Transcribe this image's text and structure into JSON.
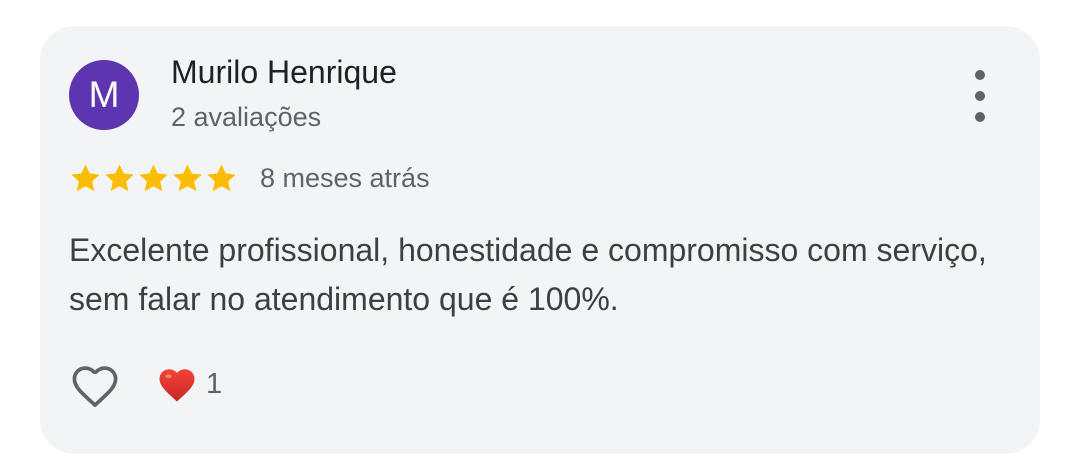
{
  "review": {
    "author_initial": "M",
    "author_name": "Murilo Henrique",
    "author_reviews": "2 avaliações",
    "rating": 5,
    "rating_max": 5,
    "time_ago": "8 meses atrás",
    "text": "Excelente profissional, honestidade e compromisso com serviço, sem falar no atendimento que é 100%.",
    "reaction_count": "1"
  },
  "icons": {
    "more": "more-vert-icon",
    "star": "star-icon",
    "like": "heart-outline-icon",
    "reaction": "red-heart-icon"
  },
  "colors": {
    "card_bg": "#f3f4f6",
    "avatar_bg": "#5e35b1",
    "star": "#fbbc04",
    "reaction_heart": "#e53935",
    "text_primary": "#202124",
    "text_secondary": "#5f6368"
  }
}
